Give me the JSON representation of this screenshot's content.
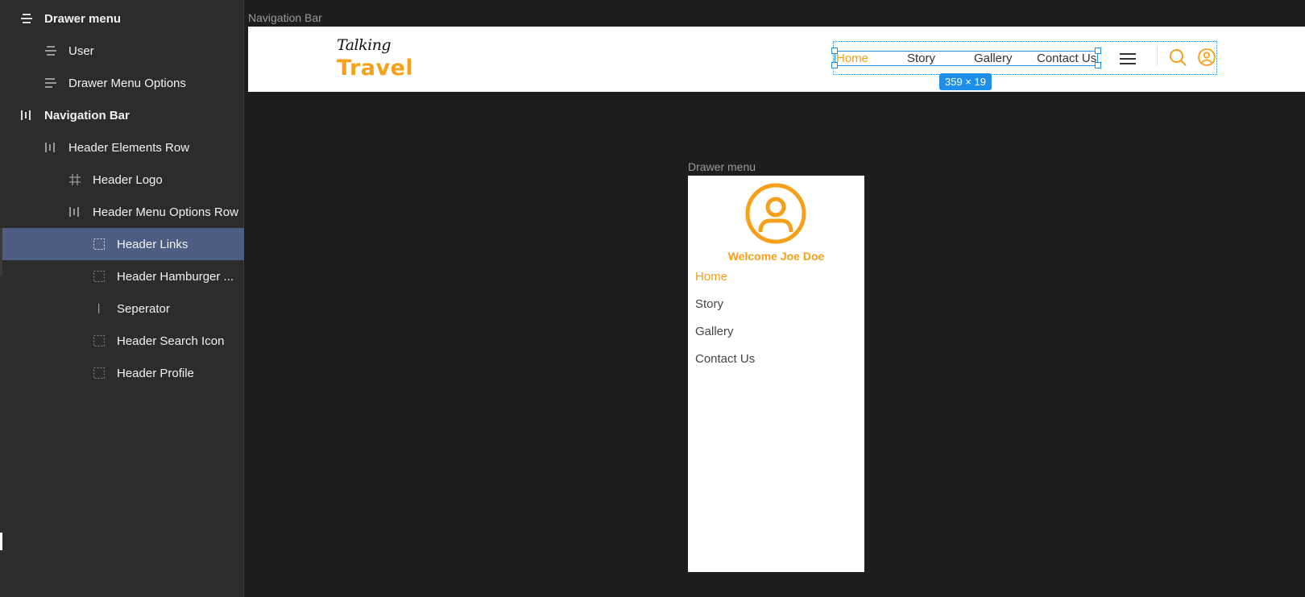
{
  "layers": [
    {
      "label": "Drawer menu",
      "icon": "stack-layout-icon",
      "bold": true,
      "selected": false
    },
    {
      "label": "User",
      "icon": "stack-layout-icon",
      "bold": false,
      "selected": false
    },
    {
      "label": "Drawer Menu Options",
      "icon": "stack-layout-icon",
      "bold": false,
      "selected": false
    },
    {
      "label": "Navigation Bar",
      "icon": "row-layout-icon",
      "bold": true,
      "selected": false
    },
    {
      "label": "Header Elements Row",
      "icon": "row-layout-icon",
      "bold": false,
      "selected": false
    },
    {
      "label": "Header Logo",
      "icon": "frame-grid-icon",
      "bold": false,
      "selected": false
    },
    {
      "label": "Header Menu Options Row",
      "icon": "row-layout-icon",
      "bold": false,
      "selected": false
    },
    {
      "label": "Header Links",
      "icon": "dashed-frame-icon",
      "bold": false,
      "selected": true
    },
    {
      "label": "Header Hamburger ...",
      "icon": "dashed-frame-icon",
      "bold": false,
      "selected": false
    },
    {
      "label": "Seperator",
      "icon": "line-icon",
      "bold": false,
      "selected": false
    },
    {
      "label": "Header Search Icon",
      "icon": "dashed-frame-icon",
      "bold": false,
      "selected": false
    },
    {
      "label": "Header Profile",
      "icon": "dashed-frame-icon",
      "bold": false,
      "selected": false
    }
  ],
  "canvas": {
    "navbar_frame_label": "Navigation Bar",
    "drawer_frame_label": "Drawer menu",
    "selection_size": "359 × 19"
  },
  "navbar": {
    "logo_script": "Talking",
    "logo_main": "Travel",
    "links": [
      "Home",
      "Story",
      "Gallery",
      "Contact Us"
    ],
    "active_link": "Home"
  },
  "drawer": {
    "welcome": "Welcome Joe Doe",
    "links": [
      "Home",
      "Story",
      "Gallery",
      "Contact Us"
    ],
    "active_link": "Home"
  },
  "colors": {
    "accent": "#f6a01a",
    "selection": "#1e8fe8",
    "panel_bg": "#2c2c2c",
    "canvas_bg": "#1e1e1e",
    "selected_layer": "#4e5e82"
  }
}
